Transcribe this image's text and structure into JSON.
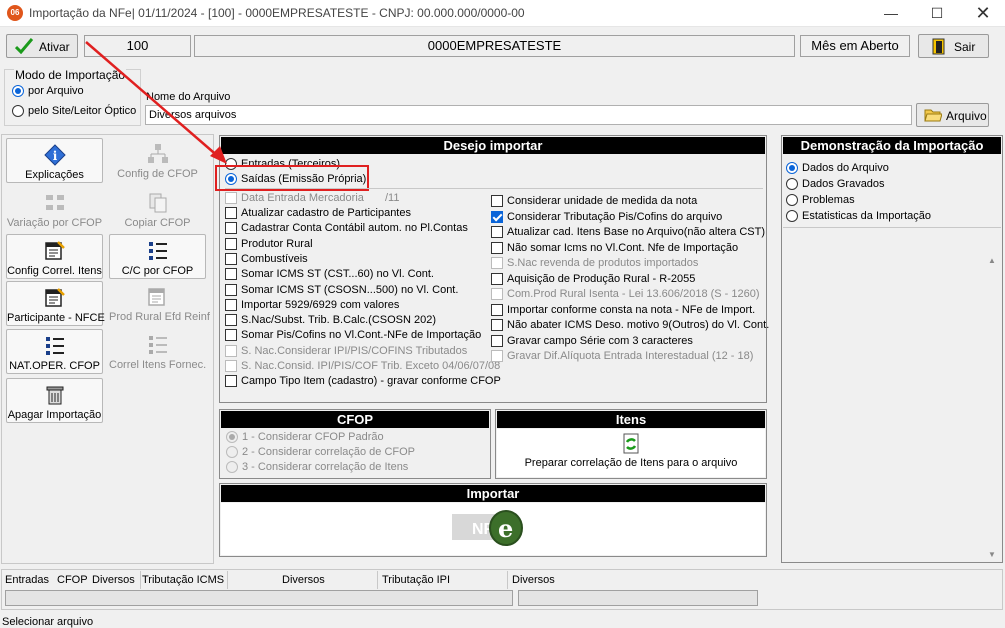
{
  "window": {
    "title": "Importação da NFe|  01/11/2024 - [100] - 0000EMPRESATESTE - CNPJ: 00.000.000/0000-00",
    "icon_text": "06",
    "controls": [
      "minimize-icon",
      "maximize-icon",
      "close-icon"
    ]
  },
  "toolbar": {
    "activate_label": "Ativar",
    "company_code": "100",
    "company_name": "0000EMPRESATESTE",
    "period_status": "Mês em Aberto",
    "exit_label": "Sair"
  },
  "import_mode": {
    "label": "Modo de Importação",
    "options": [
      "por Arquivo",
      "pelo Site/Leitor Óptico"
    ],
    "selected": 0
  },
  "file": {
    "label": "Nome do Arquivo",
    "value": "Diversos arquivos",
    "button_label": "Arquivo"
  },
  "tiles": [
    {
      "label": "Explicações",
      "enabled": true,
      "icon": "info-icon"
    },
    {
      "label": "Config de CFOP",
      "enabled": false,
      "icon": "hierarchy-icon"
    },
    {
      "label": "Variação por CFOP",
      "enabled": false,
      "icon": "grid-icon"
    },
    {
      "label": "Copiar CFOP",
      "enabled": false,
      "icon": "copy-icon"
    },
    {
      "label": "Config Correl. Itens",
      "enabled": true,
      "icon": "calendar-edit-icon"
    },
    {
      "label": "C/C por CFOP",
      "enabled": true,
      "icon": "list-icon"
    },
    {
      "label": "Participante - NFCE",
      "enabled": true,
      "icon": "calendar-edit-icon"
    },
    {
      "label": "Prod Rural Efd Reinf",
      "enabled": false,
      "icon": "calendar-edit-icon"
    },
    {
      "label": "NAT.OPER. CFOP",
      "enabled": true,
      "icon": "list-icon"
    },
    {
      "label": "Correl Itens Fornec.",
      "enabled": false,
      "icon": "list-icon"
    },
    {
      "label": "Apagar Importação",
      "enabled": true,
      "icon": "trash-icon"
    }
  ],
  "desejo": {
    "header": "Desejo importar",
    "types": [
      "Entradas (Terceiros)",
      "Saídas (Emissão Própria)"
    ],
    "selected_type": 1,
    "date_label": "Data Entrada Mercadoria",
    "date_value": "/11",
    "left_options": [
      {
        "label": "Atualizar cadastro de Participantes",
        "checked": false,
        "enabled": true
      },
      {
        "label": "Cadastrar Conta Contábil autom. no Pl.Contas",
        "checked": false,
        "enabled": true
      },
      {
        "label": "Produtor Rural",
        "checked": false,
        "enabled": true
      },
      {
        "label": "Combustíveis",
        "checked": false,
        "enabled": true
      },
      {
        "label": "Somar ICMS ST (CST...60) no Vl. Cont.",
        "checked": false,
        "enabled": true
      },
      {
        "label": "Somar ICMS ST (CSOSN...500) no Vl. Cont.",
        "checked": false,
        "enabled": true
      },
      {
        "label": "Importar 5929/6929 com valores",
        "checked": false,
        "enabled": true
      },
      {
        "label": "S.Nac/Subst. Trib. B.Calc.(CSOSN 202)",
        "checked": false,
        "enabled": true
      },
      {
        "label": "Somar Pis/Cofins no Vl.Cont.-NFe de Importação",
        "checked": false,
        "enabled": true
      },
      {
        "label": "S. Nac.Considerar IPI/PIS/COFINS Tributados",
        "checked": false,
        "enabled": false
      },
      {
        "label": "S. Nac.Consid. IPI/PIS/COF Trib. Exceto 04/06/07/08",
        "checked": false,
        "enabled": false
      },
      {
        "label": "Campo Tipo Item (cadastro) - gravar conforme CFOP",
        "checked": false,
        "enabled": true
      }
    ],
    "right_options": [
      {
        "label": "Considerar unidade de medida da nota",
        "checked": false,
        "enabled": true
      },
      {
        "label": "Considerar Tributação Pis/Cofins do arquivo",
        "checked": true,
        "enabled": true
      },
      {
        "label": "Atualizar cad. Itens Base no Arquivo(não altera CST)",
        "checked": false,
        "enabled": true
      },
      {
        "label": "Não somar Icms no Vl.Cont. Nfe de Importação",
        "checked": false,
        "enabled": true
      },
      {
        "label": "S.Nac revenda de produtos importados",
        "checked": false,
        "enabled": false
      },
      {
        "label": "Aquisição de Produção Rural - R-2055",
        "checked": false,
        "enabled": true
      },
      {
        "label": "Com.Prod Rural Isenta - Lei 13.606/2018 (S - 1260)",
        "checked": false,
        "enabled": false
      },
      {
        "label": "Importar conforme consta na nota - NFe de Import.",
        "checked": false,
        "enabled": true
      },
      {
        "label": "Não abater ICMS Deso. motivo 9(Outros) do Vl. Cont.",
        "checked": false,
        "enabled": true
      },
      {
        "label": "Gravar campo Série com 3 caracteres",
        "checked": false,
        "enabled": true
      },
      {
        "label": "Gravar Dif.Alíquota Entrada Interestadual (12 - 18)",
        "checked": false,
        "enabled": false
      }
    ]
  },
  "cfop": {
    "header": "CFOP",
    "options": [
      "1 - Considerar CFOP Padrão",
      "2 - Considerar correlação de CFOP",
      "3 - Considerar correlação de Itens"
    ],
    "selected": 0
  },
  "itens": {
    "header": "Itens",
    "button_label": "Preparar correlação de Itens para o arquivo"
  },
  "importar": {
    "header": "Importar",
    "logo_text": "NF"
  },
  "demo": {
    "header": "Demonstração da Importação",
    "options": [
      "Dados do Arquivo",
      "Dados Gravados",
      "Problemas",
      "Estatisticas da Importação"
    ],
    "selected": 0
  },
  "bottom": {
    "columns": [
      "Entradas",
      "CFOP",
      "Diversos",
      "Tributação ICMS",
      "Diversos",
      "Tributação IPI",
      "Diversos"
    ]
  },
  "status": {
    "text": "Selecionar arquivo"
  },
  "annotation_color": "#e02020"
}
